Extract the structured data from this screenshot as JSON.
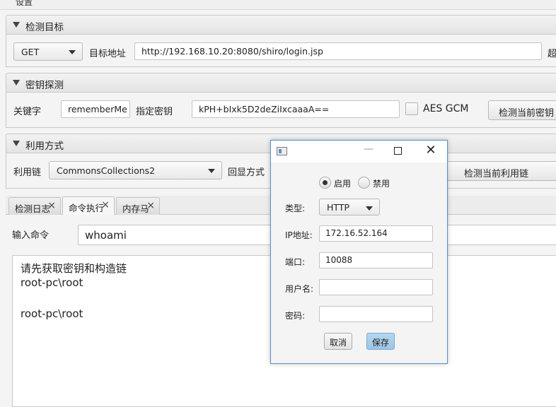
{
  "menu": {
    "settings_label": "设置"
  },
  "target": {
    "section_title": "检测目标",
    "method": "GET",
    "url_label": "目标地址",
    "url_value": "http://192.168.10.20:8080/shiro/login.jsp",
    "overflow_label": "超"
  },
  "key": {
    "section_title": "密钥探测",
    "keyword_label": "关键字",
    "keyword_value": "rememberMe",
    "key_label": "指定密钥",
    "key_value": "kPH+bIxk5D2deZiIxcaaaA==",
    "aes_gcm_label": "AES GCM",
    "check_key_button": "检测当前密钥"
  },
  "exploit": {
    "section_title": "利用方式",
    "chain_label": "利用链",
    "chain_value": "CommonsCollections2",
    "echo_label": "回显方式",
    "check_chain_button": "检测当前利用链"
  },
  "tabs": [
    {
      "label": "检测日志"
    },
    {
      "label": "命令执行"
    },
    {
      "label": "内存马"
    }
  ],
  "command": {
    "input_label": "输入命令",
    "input_value": "whoami"
  },
  "output_lines": [
    "请先获取密钥和构造链",
    "root-pc\\root",
    "",
    "root-pc\\root"
  ],
  "proxy_dialog": {
    "enable_label": "启用",
    "disable_label": "禁用",
    "type_label": "类型:",
    "type_value": "HTTP",
    "ip_label": "IP地址:",
    "ip_value": "172.16.52.164",
    "port_label": "端口:",
    "port_value": "10088",
    "username_label": "用户名:",
    "username_value": "",
    "password_label": "密码:",
    "password_value": "",
    "cancel_button": "取消",
    "save_button": "保存"
  }
}
